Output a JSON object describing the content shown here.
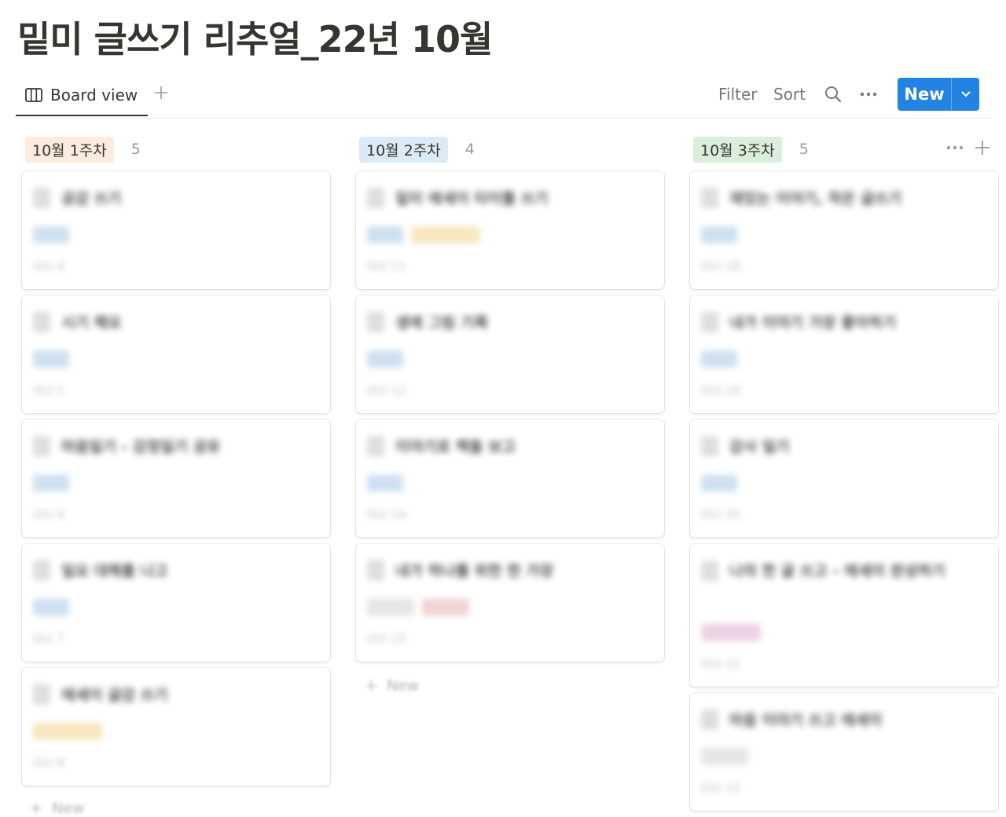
{
  "page_title": "밑미 글쓰기 리추얼_22년 10월",
  "view_tab": {
    "label": "Board view",
    "icon": "board-icon"
  },
  "toolbar": {
    "filter": "Filter",
    "sort": "Sort",
    "search_icon": "search-icon",
    "more_icon": "more-icon",
    "new": "New"
  },
  "new_card_label": "New",
  "colors": {
    "accent": "#2383e2",
    "group_week1": "#fbecdd",
    "group_week2": "#dbeaf4",
    "group_week3": "#dbeddb",
    "tag_blue": "#c6dbee",
    "tag_yellow": "#f6e2b5",
    "tag_red": "#eecccb",
    "tag_pink": "#eacbdf",
    "tag_gray": "#e3e2e0"
  },
  "columns": [
    {
      "label": "10월 1주차",
      "count": "5",
      "cards": [
        {
          "title": "공감 쓰기",
          "date": "Oct 4"
        },
        {
          "title": "시기 해요",
          "date": "Oct 5"
        },
        {
          "title": "마음일기 - 감정일기 공유",
          "date": "Oct 6"
        },
        {
          "title": "일요 대해를 나고",
          "date": "Oct 7"
        },
        {
          "title": "에세이 글감 쓰기",
          "date": "Oct 8"
        }
      ]
    },
    {
      "label": "10월 2주차",
      "count": "4",
      "cards": [
        {
          "title": "밑미 에세이 타이틀 쓰기",
          "date": "Oct 11"
        },
        {
          "title": "생애 그림 기록",
          "date": "Oct 12"
        },
        {
          "title": "이야기로 책들 보고",
          "date": "Oct 14"
        },
        {
          "title": "내가 하나를 위한 한 가장",
          "date": "Oct 15"
        }
      ]
    },
    {
      "label": "10월 3주차",
      "count": "5",
      "cards": [
        {
          "title": "재밌는 이야기, 작은 글쓰기",
          "date": "Oct 18"
        },
        {
          "title": "내가 이야기 가장 좋아하기",
          "date": "Oct 19"
        },
        {
          "title": "감사 일기",
          "date": "Oct 20"
        },
        {
          "title": "나의 한 글 쓰고 - 에세이 완성하기",
          "date": "Oct 22"
        },
        {
          "title": "마음 이야기 쓰고 에세이",
          "date": "Oct 23"
        }
      ]
    }
  ]
}
